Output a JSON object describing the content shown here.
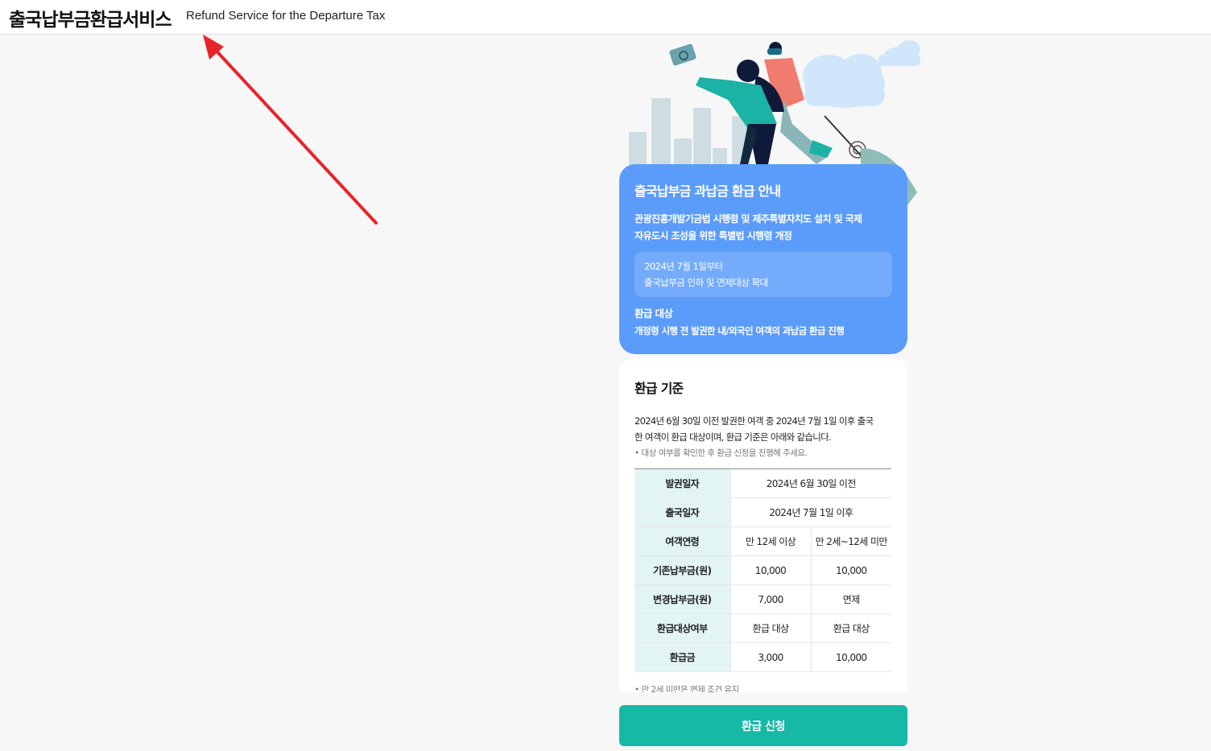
{
  "header": {
    "title_ko": "출국납부금환급서비스",
    "title_en": "Refund Service for the Departure Tax"
  },
  "info_card": {
    "title": "출국납부금 과납금 환급 안내",
    "description_line1": "관광진흥개발기금법 시행령 및 제주특별자치도 설치 및 국제",
    "description_line2": "자유도시 조성을 위한 특별법 시행령 개정",
    "highlight_line1": "2024년 7월 1일부터",
    "highlight_line2": "출국납부금 인하 및 면제대상 확대",
    "target_label": "환급 대상",
    "target_text": "개정령 시행 전 발권한 내/외국인 여객의 과납금 환급 진행"
  },
  "criteria": {
    "title": "환급 기준",
    "description_line1": "2024년 6월 30일 이전 발권한 여객 중 2024년 7월 1일 이후 출국",
    "description_line2": "한 여객이 환급 대상이며, 환급 기준은 아래와 같습니다.",
    "note": "• 대상 여부를 확인한 후 환급 신청을 진행해 주세요.",
    "rows": {
      "issue_date": {
        "label": "발권일자",
        "value": "2024년 6월 30일 이전"
      },
      "departure_date": {
        "label": "출국일자",
        "value": "2024년 7월 1일 이후"
      },
      "age": {
        "label": "여객연령",
        "col1": "만 12세 이상",
        "col2": "만 2세~12세 미만"
      },
      "old_fee": {
        "label": "기존납부금(원)",
        "col1": "10,000",
        "col2": "10,000"
      },
      "new_fee": {
        "label": "변경납부금(원)",
        "col1": "7,000",
        "col2": "면제"
      },
      "eligible": {
        "label": "환급대상여부",
        "col1": "환급 대상",
        "col2": "환급 대상"
      },
      "refund": {
        "label": "환급금",
        "col1": "3,000",
        "col2": "10,000"
      }
    },
    "footnote": "• 만 2세 미만은 면제 조건 유지"
  },
  "apply_button": {
    "label": "환급 신청"
  },
  "colors": {
    "info_card_bg": "#5b9cfb",
    "apply_button_bg": "#16b8a6",
    "table_label_bg": "#e3f4f4",
    "annotation_arrow": "#e8232a"
  },
  "icons": [
    "travelers-illustration",
    "annotation-arrow"
  ]
}
